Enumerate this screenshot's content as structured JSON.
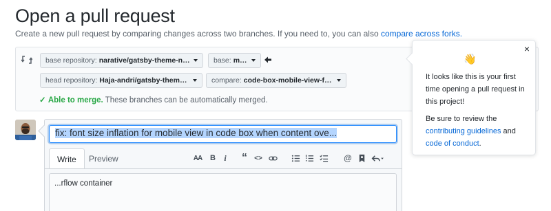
{
  "header": {
    "title": "Open a pull request",
    "subtitle": "Create a new pull request by comparing changes across two branches. If you need to, you can also",
    "subtitle_link": "compare across forks."
  },
  "range": {
    "base_repo_label": "base repository:",
    "base_repo_value": "narative/gatsby-theme-novela",
    "base_label": "base:",
    "base_value": "master",
    "head_repo_label": "head repository:",
    "head_repo_value": "Haja-andri/gatsby-theme-n...",
    "compare_label": "compare:",
    "compare_value": "code-box-mobile-view-font-...",
    "merge_ok": "Able to merge.",
    "merge_text": "These branches can be automatically merged."
  },
  "form": {
    "title_value": "fix: font size inflation for mobile view in code box when content ove...",
    "tabs": [
      {
        "label": "Write"
      },
      {
        "label": "Preview"
      }
    ],
    "toolbar": {
      "heading": "AA",
      "bold": "B",
      "italic": "i",
      "quote": "“",
      "code": "<>",
      "mention": "@"
    },
    "body_value": "...rflow container"
  },
  "popover": {
    "close": "×",
    "wave": "👋",
    "line1": "It looks like this is your first time opening a pull request in this project!",
    "line2_pre": "Be sure to review the",
    "link1": "contributing guidelines",
    "line2_mid": "and",
    "link2": "code of conduct",
    "line2_end": "."
  },
  "colors": {
    "accent": "#0366d6",
    "success": "#28a745",
    "selection": "#b4d5fe"
  }
}
